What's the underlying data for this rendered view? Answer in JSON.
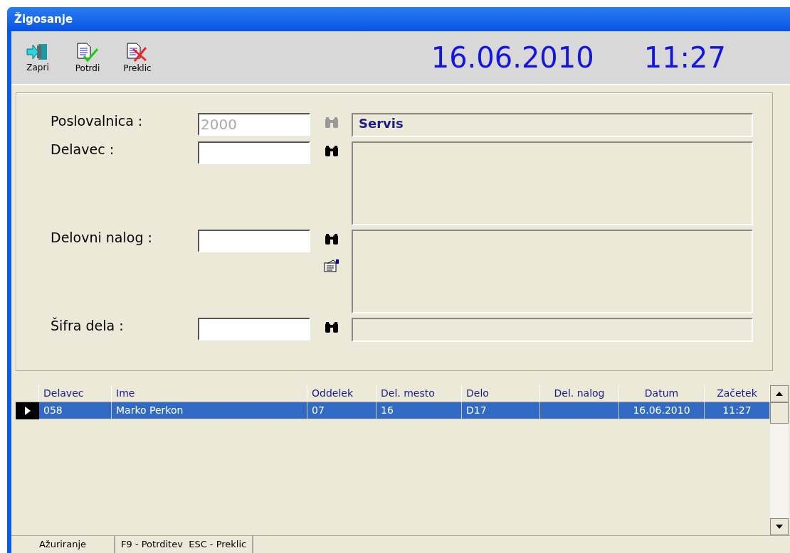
{
  "window": {
    "title": "Žigosanje"
  },
  "toolbar": {
    "buttons": [
      {
        "label": "Zapri",
        "kind": "close"
      },
      {
        "label": "Potrdi",
        "kind": "confirm"
      },
      {
        "label": "Preklic",
        "kind": "cancel"
      }
    ],
    "date": "16.06.2010",
    "time": "11:27"
  },
  "form": {
    "fields": [
      {
        "label": "Poslovalnica :",
        "value": "2000",
        "disabled": true,
        "kind": "single",
        "info": "Servis",
        "details": false
      },
      {
        "label": "Delavec :",
        "disabled": false,
        "kind": "tall",
        "details": false
      },
      {
        "label": "Delovni nalog :",
        "disabled": false,
        "kind": "tall",
        "details": true
      },
      {
        "label": "Šifra dela :",
        "disabled": false,
        "kind": "single",
        "details": false
      }
    ]
  },
  "table": {
    "columns": [
      "Delavec",
      "Ime",
      "Oddelek",
      "Del. mesto",
      "Delo",
      "Del. nalog",
      "Datum",
      "Začetek"
    ],
    "rows": [
      {
        "selected": true,
        "cells": [
          "058",
          "Marko Perkon",
          "07",
          "16",
          "D17",
          "",
          "16.06.2010",
          "11:27"
        ]
      }
    ]
  },
  "status_bar": {
    "mode": "Ažuriranje",
    "hint": "F9 - Potrditev  ESC - Preklic"
  }
}
